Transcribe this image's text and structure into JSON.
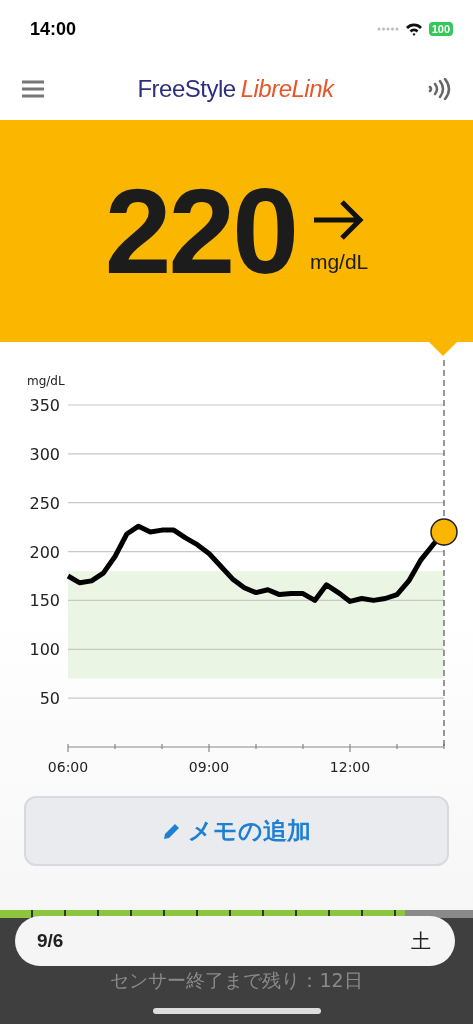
{
  "status_bar": {
    "time": "14:00",
    "battery": "100"
  },
  "header": {
    "logo_brand": "FreeStyle",
    "logo_product": "LibreLink"
  },
  "reading": {
    "value": "220",
    "unit": "mg/dL",
    "trend_arrow": {
      "kind": "flat"
    }
  },
  "chart": {
    "chart_data": {
      "type": "line",
      "ylabel": "mg/dL",
      "x": [
        6,
        6.25,
        6.5,
        6.75,
        7,
        7.25,
        7.5,
        7.75,
        8,
        8.25,
        8.5,
        8.75,
        9,
        9.25,
        9.5,
        9.75,
        10,
        10.25,
        10.5,
        10.75,
        11,
        11.25,
        11.5,
        11.75,
        12,
        12.25,
        12.5,
        12.75,
        13,
        13.25,
        13.5,
        13.75,
        14
      ],
      "series": [
        {
          "color": "#000000",
          "values": [
            175,
            168,
            170,
            178,
            195,
            218,
            226,
            220,
            222,
            222,
            214,
            207,
            198,
            185,
            172,
            163,
            158,
            161,
            156,
            157,
            157,
            150,
            166,
            158,
            149,
            152,
            150,
            152,
            156,
            170,
            191,
            206,
            220
          ]
        }
      ],
      "ylim": [
        0,
        350
      ],
      "yticks": [
        50,
        100,
        150,
        200,
        250,
        300,
        350
      ],
      "xlim": [
        6,
        14
      ],
      "xticks": [
        {
          "value": 6,
          "label": "06:00"
        },
        {
          "value": 9,
          "label": "09:00"
        },
        {
          "value": 12,
          "label": "12:00"
        }
      ],
      "grid": true,
      "bands": [
        {
          "axis": "y",
          "from": 70,
          "to": 180
        }
      ]
    }
  },
  "memo_button": {
    "label": "メモの追加"
  },
  "sensor": {
    "level": 0.857,
    "date": "9/6",
    "weekday": "土",
    "remaining": "センサー終了まで残り：12日"
  }
}
